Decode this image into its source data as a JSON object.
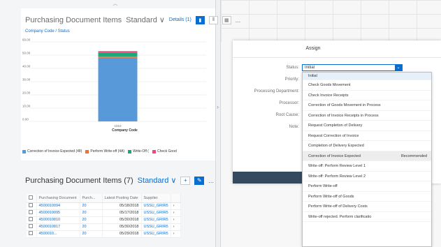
{
  "chart_panel": {
    "title": "Purchasing Document Items",
    "variant": "Standard",
    "details_label": "Details (1)",
    "subtitle": "Company Code / Status",
    "more": "..."
  },
  "chart_data": {
    "type": "bar",
    "stacked": true,
    "categories": [
      "1010"
    ],
    "series": [
      {
        "name": "Correction of Invoice Expected (48)",
        "color": "#5899da",
        "values": [
          48
        ]
      },
      {
        "name": "Perform Write-off (4A)",
        "color": "#e8743b",
        "values": [
          1
        ]
      },
      {
        "name": "Write-Off (",
        "color": "#19a979",
        "values": [
          3
        ]
      },
      {
        "name": "Check Good",
        "color": "#ed4a7b",
        "values": [
          1
        ]
      }
    ],
    "xlabel": "Company Code",
    "ylabel": "",
    "y_ticks": [
      "60.00",
      "50.00",
      "40.00",
      "30.00",
      "20.00",
      "10.00",
      "0.00"
    ],
    "ylim": [
      0,
      60
    ],
    "legend_position": "bottom"
  },
  "table_panel": {
    "title": "Purchasing Document Items (7)",
    "variant": "Standard",
    "add_icon": "+",
    "more": "...",
    "columns": [
      "Purchasing Document",
      "Purch...",
      "Latest Posting Date",
      "Supplier"
    ],
    "rows": [
      {
        "doc": "4500010094",
        "item": "20",
        "date": "05/18/2018",
        "supplier": "USSU_GRIR5"
      },
      {
        "doc": "4500010095",
        "item": "20",
        "date": "05/17/2018",
        "supplier": "USSU_GRIR5"
      },
      {
        "doc": "4500010810",
        "item": "20",
        "date": "05/30/2018",
        "supplier": "USSU_GRIR5"
      },
      {
        "doc": "4500010817",
        "item": "20",
        "date": "05/30/2018",
        "supplier": "USSU_GRIR5"
      },
      {
        "doc": "4500010...",
        "item": "20",
        "date": "05/29/2018",
        "supplier": "USSU_GRIR5"
      }
    ]
  },
  "dialog": {
    "title": "Assign",
    "labels": {
      "status": "Status:",
      "priority": "Priority:",
      "department": "Processing Department:",
      "processor": "Processor:",
      "root_cause": "Root Cause:",
      "note": "Note:"
    },
    "status_value": "Initial"
  },
  "dropdown": {
    "options": [
      "Initial",
      "Check Goods Movement",
      "Check Invoice Receipts",
      "Correction of Goods Movement in Process",
      "Correction of Invoice Receipts in Process",
      "Request Completion of Delivery",
      "Request Correction of Invoice",
      "Completion of Delivery Expected",
      "Correction of Invoice Expected",
      "Write-off: Perform Review Level 1",
      "Write-off: Perform Review Level 2",
      "Perform Write-off",
      "Perform Write-off of Goods",
      "Perform Write-off of Delivery Costs",
      "Write-off rejected. Perform clarificatio"
    ],
    "recommended_label": "Recommended"
  },
  "colors": {
    "accent": "#0a6ed1",
    "bar_blue": "#5899da",
    "bar_orange": "#e8743b",
    "bar_green": "#19a979",
    "bar_pink": "#ed4a7b",
    "dialog_footer": "#354a5f"
  }
}
